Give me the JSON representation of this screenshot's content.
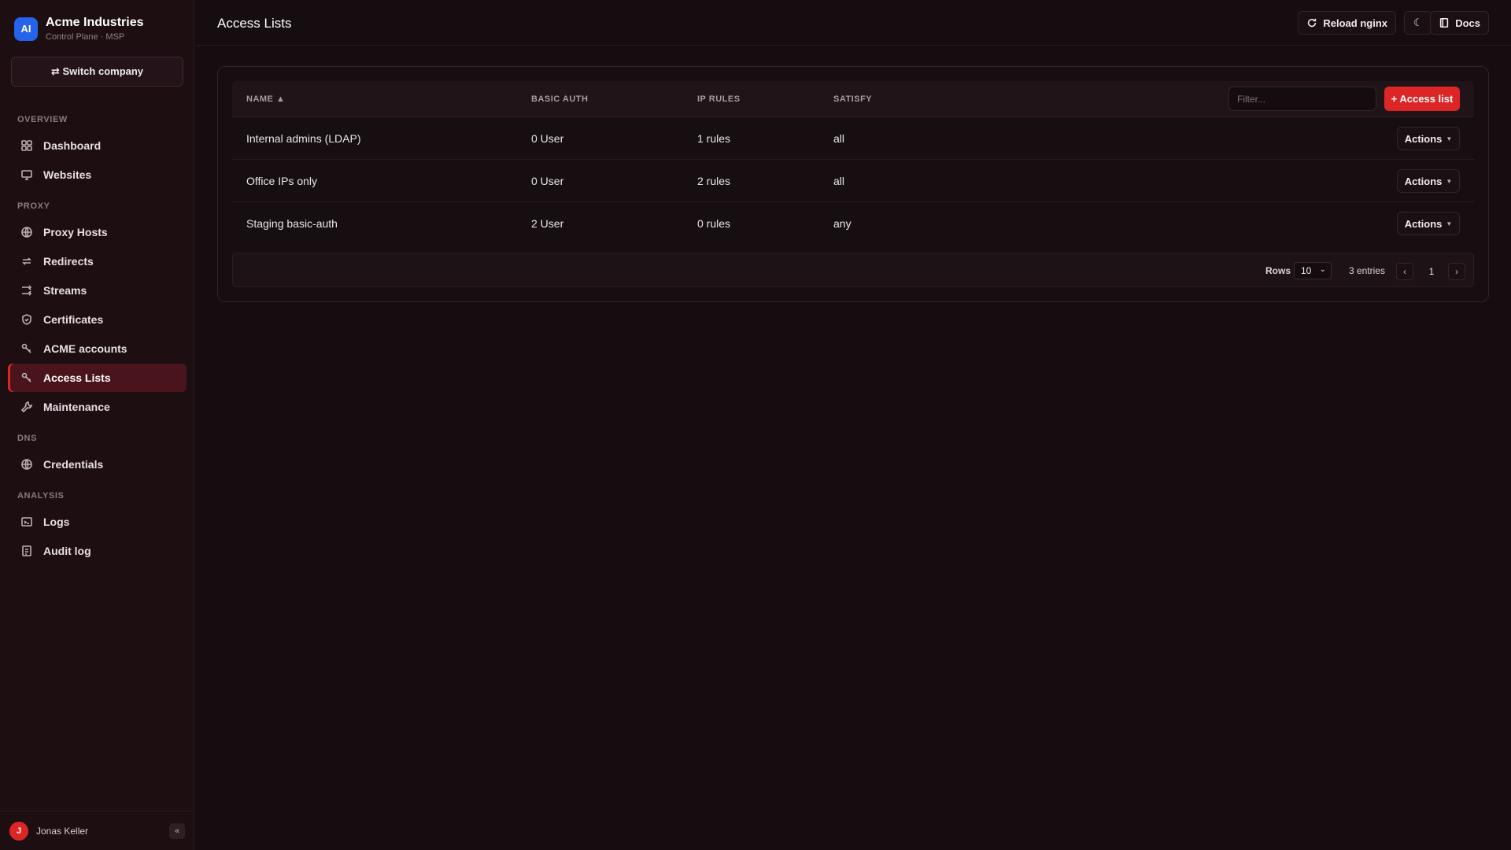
{
  "brand": {
    "logo": "AI",
    "name": "Acme Industries",
    "subtitle": "Control Plane · MSP"
  },
  "switch_company": "⇄ Switch company",
  "sidebar": {
    "sections": {
      "overview": "OVERVIEW",
      "proxy": "PROXY",
      "dns": "DNS",
      "analysis": "ANALYSIS"
    },
    "items": {
      "dashboard": {
        "label": "Dashboard",
        "icon": "grid-icon"
      },
      "websites": {
        "label": "Websites",
        "icon": "monitor-icon"
      },
      "proxy_hosts": {
        "label": "Proxy Hosts",
        "icon": "globe-icon"
      },
      "redirects": {
        "label": "Redirects",
        "icon": "redirect-icon"
      },
      "streams": {
        "label": "Streams",
        "icon": "shuffle-icon"
      },
      "certificates": {
        "label": "Certificates",
        "icon": "shield-icon"
      },
      "acme_accounts": {
        "label": "ACME accounts",
        "icon": "key-icon"
      },
      "access_lists": {
        "label": "Access Lists",
        "icon": "key-icon",
        "active": true
      },
      "maintenance": {
        "label": "Maintenance",
        "icon": "wrench-icon"
      },
      "credentials": {
        "label": "Credentials",
        "icon": "globe-icon"
      },
      "logs": {
        "label": "Logs",
        "icon": "terminal-icon"
      },
      "audit_log": {
        "label": "Audit log",
        "icon": "clipboard-icon"
      }
    },
    "user": {
      "initial": "J",
      "name": "Jonas Keller"
    },
    "collapse": "«"
  },
  "header": {
    "title": "Access Lists",
    "reload_label": "Reload nginx",
    "theme_icon": "☾",
    "docs_label": "Docs"
  },
  "table": {
    "columns": {
      "name": "NAME ▲",
      "basic_auth": "BASIC AUTH",
      "ip_rules": "IP RULES",
      "satisfy": "SATISFY"
    },
    "filter_placeholder": "Filter...",
    "add_label": "+ Access list",
    "rows": [
      {
        "name": "Internal admins (LDAP)",
        "basic_auth": "0 User",
        "ip_rules": "1 rules",
        "satisfy": "all",
        "actions": "Actions"
      },
      {
        "name": "Office IPs only",
        "basic_auth": "0 User",
        "ip_rules": "2 rules",
        "satisfy": "all",
        "actions": "Actions"
      },
      {
        "name": "Staging basic-auth",
        "basic_auth": "2 User",
        "ip_rules": "0 rules",
        "satisfy": "any",
        "actions": "Actions"
      }
    ]
  },
  "pagination": {
    "rows_label": "Rows",
    "rows_value": "10",
    "entries": "3 entries",
    "prev": "‹",
    "page": "1",
    "next": "›"
  },
  "colors": {
    "accent": "#dc2626",
    "brand": "#2563eb",
    "background": "#150d10"
  }
}
